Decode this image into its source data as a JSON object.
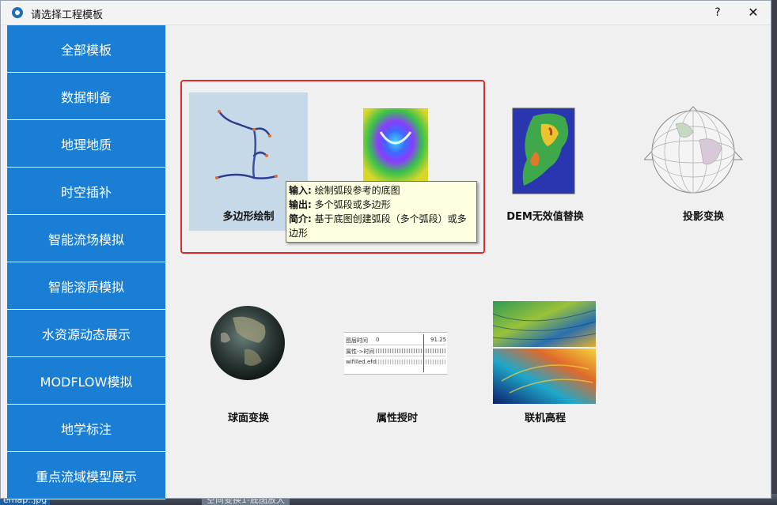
{
  "window": {
    "title": "请选择工程模板",
    "help_label": "?",
    "close_label": "✕"
  },
  "sidebar": {
    "items": [
      {
        "label": "全部模板"
      },
      {
        "label": "数据制备"
      },
      {
        "label": "地理地质"
      },
      {
        "label": "时空插补"
      },
      {
        "label": "智能流场模拟"
      },
      {
        "label": "智能溶质模拟"
      },
      {
        "label": "水资源动态展示"
      },
      {
        "label": "MODFLOW模拟"
      },
      {
        "label": "地学标注"
      },
      {
        "label": "重点流域模型展示"
      }
    ]
  },
  "templates": [
    {
      "label": "多边形绘制",
      "icon": "polyline-drawing-icon"
    },
    {
      "label": "",
      "icon": "dem-surface-icon"
    },
    {
      "label": "DEM无效值替换",
      "icon": "dem-map-icon"
    },
    {
      "label": "投影变换",
      "icon": "globe-projection-icon"
    },
    {
      "label": "球面变换",
      "icon": "earth-sphere-icon"
    },
    {
      "label": "属性授时",
      "icon": "attribute-timeline-icon"
    },
    {
      "label": "联机高程",
      "icon": "online-elevation-icon"
    }
  ],
  "tooltip": {
    "input_key": "输入:",
    "input_val": " 绘制弧段参考的底图",
    "output_key": "输出:",
    "output_val": " 多个弧段或多边形",
    "intro_key": "简介:",
    "intro_val": " 基于底图创建弧段（多个弧段）或多边形"
  },
  "attribute_panel": {
    "row1_label": "图层时间",
    "row1_start": "0",
    "row1_end": "91.25",
    "row2_label": "属性->时间",
    "row3_label": "wifilled.efd"
  },
  "background": {
    "file_label": "emap..jpg",
    "title_label": "空间变换1-底图放大"
  },
  "colors": {
    "sidebar_bg": "#1a7fd4",
    "selection_border": "#e02a2a",
    "hover_bg": "#c5d9e8",
    "tooltip_bg": "#ffffe1"
  }
}
